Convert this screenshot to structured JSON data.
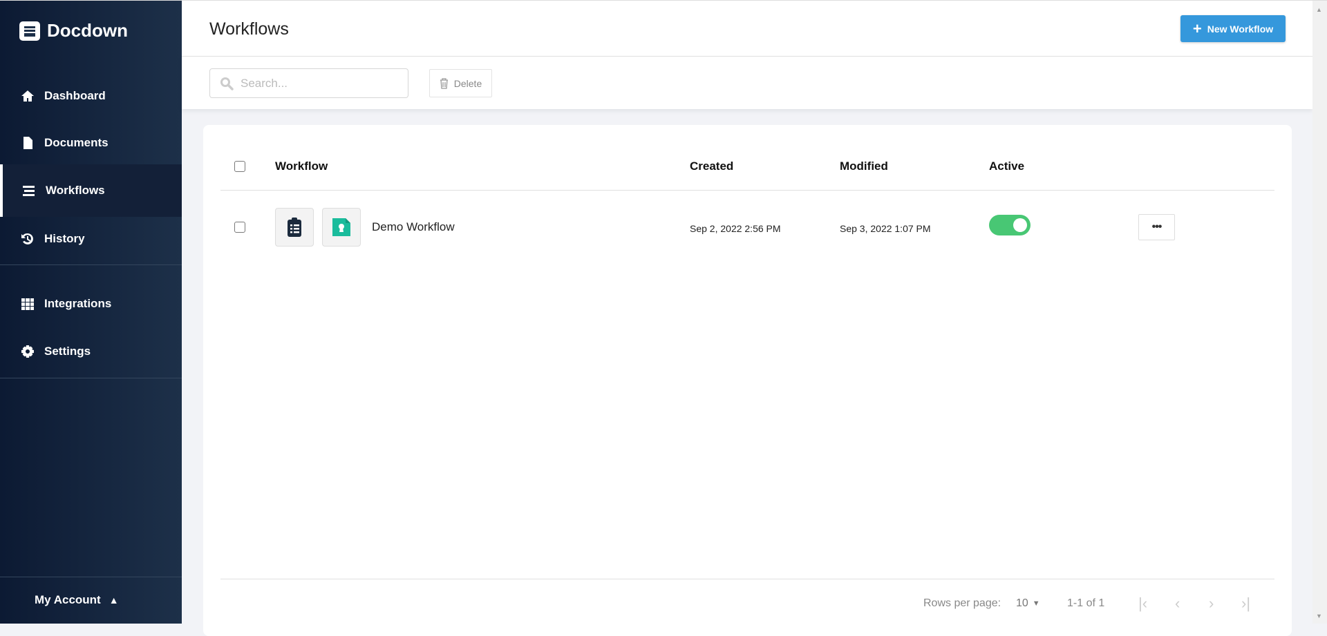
{
  "app": {
    "name": "Docdown"
  },
  "sidebar": {
    "items": [
      {
        "label": "Dashboard"
      },
      {
        "label": "Documents"
      },
      {
        "label": "Workflows"
      },
      {
        "label": "History"
      },
      {
        "label": "Integrations"
      },
      {
        "label": "Settings"
      }
    ],
    "account_label": "My Account"
  },
  "header": {
    "title": "Workflows",
    "new_button": "New Workflow"
  },
  "toolbar": {
    "search_placeholder": "Search...",
    "delete_label": "Delete"
  },
  "table": {
    "columns": [
      "Workflow",
      "Created",
      "Modified",
      "Active"
    ],
    "rows": [
      {
        "name": "Demo Workflow",
        "created": "Sep 2, 2022 2:56 PM",
        "modified": "Sep 3, 2022 1:07 PM",
        "active": true,
        "more": "•••"
      }
    ]
  },
  "pagination": {
    "rows_per_page_label": "Rows per page:",
    "rows_per_page": "10",
    "range": "1-1 of 1"
  },
  "colors": {
    "accent": "#3598dc",
    "toggle_on": "#48c774",
    "icon_green": "#1abc9c"
  }
}
